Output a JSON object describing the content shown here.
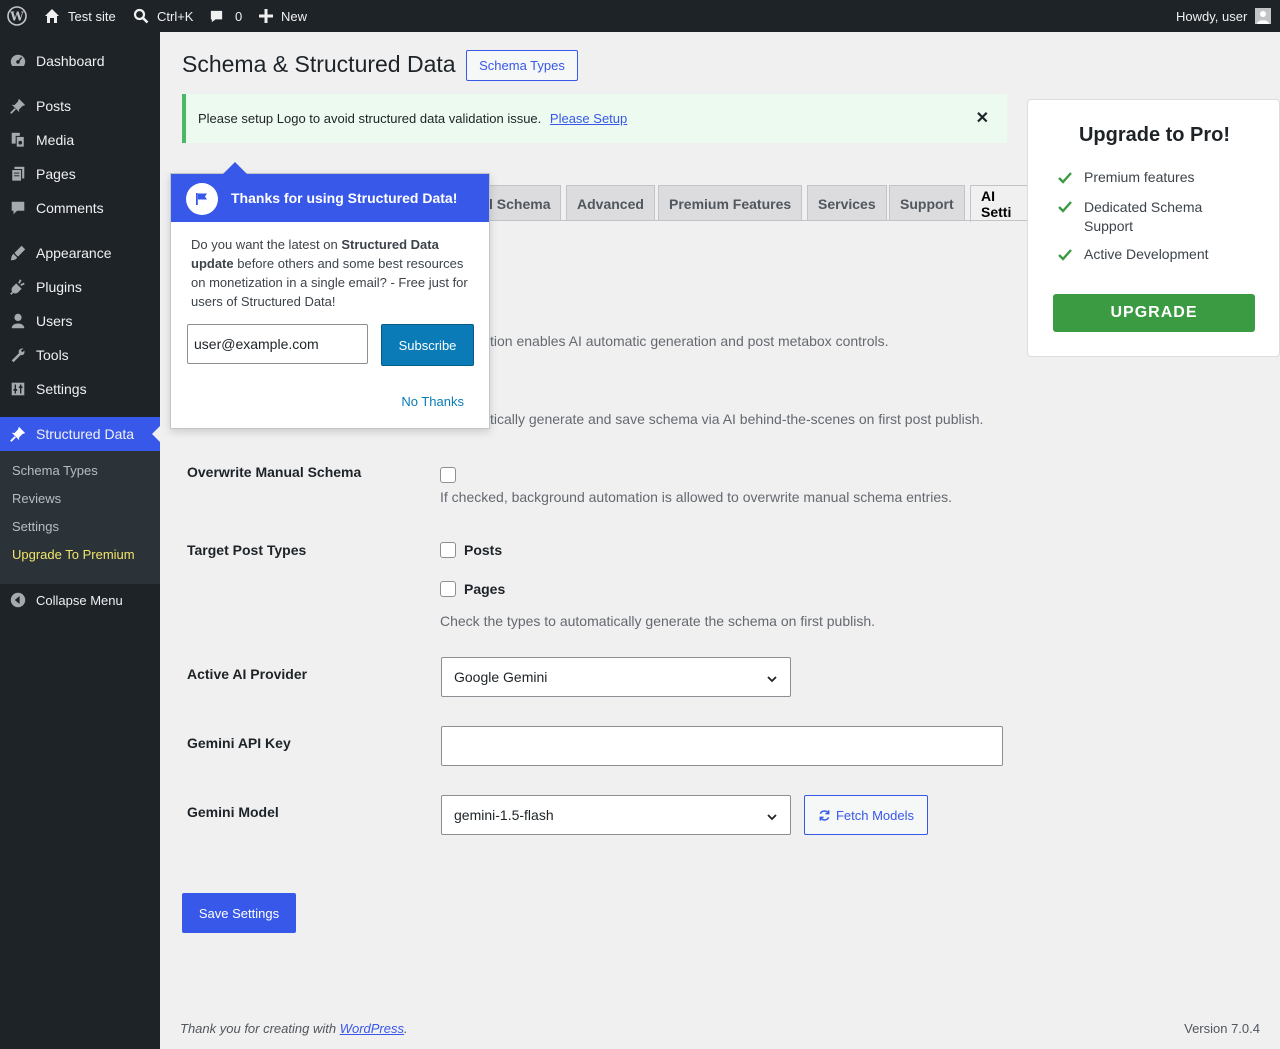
{
  "admin_bar": {
    "site_name": "Test site",
    "search_shortcut": "Ctrl+K",
    "comments_count": "0",
    "new_label": "New",
    "howdy": "Howdy, user"
  },
  "sidebar": {
    "items": [
      {
        "label": "Dashboard",
        "icon": "dashboard-icon"
      },
      {
        "label": "Posts",
        "icon": "pin-icon"
      },
      {
        "label": "Media",
        "icon": "media-icon"
      },
      {
        "label": "Pages",
        "icon": "pages-icon"
      },
      {
        "label": "Comments",
        "icon": "comment-icon"
      },
      {
        "label": "Appearance",
        "icon": "brush-icon"
      },
      {
        "label": "Plugins",
        "icon": "plugin-icon"
      },
      {
        "label": "Users",
        "icon": "user-icon"
      },
      {
        "label": "Tools",
        "icon": "wrench-icon"
      },
      {
        "label": "Settings",
        "icon": "settings-icon"
      },
      {
        "label": "Structured Data",
        "icon": "pin-icon"
      }
    ],
    "submenu": [
      "Schema Types",
      "Reviews",
      "Settings",
      "Upgrade To Premium"
    ],
    "collapse_label": "Collapse Menu",
    "active_color": "#3858e9"
  },
  "page": {
    "title": "Schema & Structured Data",
    "schema_types_button": "Schema Types"
  },
  "notice": {
    "text": "Please setup Logo to avoid structured data validation issue.",
    "link": "Please Setup",
    "close": "✕"
  },
  "tabs": [
    "l Schema",
    "Advanced",
    "Premium Features",
    "Services",
    "Support",
    "AI Setti"
  ],
  "form": {
    "partial_desc_1": "tion enables AI automatic generation and post metabox controls.",
    "partial_desc_2": "tically generate and save schema via AI behind-the-scenes on first post publish.",
    "overwrite_label": "Overwrite Manual Schema",
    "overwrite_desc": "If checked, background automation is allowed to overwrite manual schema entries.",
    "target_label": "Target Post Types",
    "posts_label": "Posts",
    "pages_label": "Pages",
    "target_desc": "Check the types to automatically generate the schema on first publish.",
    "provider_label": "Active AI Provider",
    "provider_value": "Google Gemini",
    "api_key_label": "Gemini API Key",
    "api_key_value": "",
    "model_label": "Gemini Model",
    "model_value": "gemini-1.5-flash",
    "fetch_models": "Fetch Models",
    "save": "Save Settings"
  },
  "pro_box": {
    "title": "Upgrade to Pro!",
    "features": [
      "Premium features",
      "Dedicated Schema Support",
      "Active Development"
    ],
    "button": "UPGRADE",
    "check_color": "#3b9b42"
  },
  "popup": {
    "title": "Thanks for using Structured Data!",
    "body_pre": "Do you want the latest on ",
    "body_bold1": "Structured Data update",
    "body_post": " before others and some best resources on monetization in a single email? - Free just for users of Structured Data!",
    "email_value": "user@example.com",
    "subscribe": "Subscribe",
    "no_thanks": "No Thanks"
  },
  "footer": {
    "thanks_pre": "Thank you for creating with ",
    "thanks_link": "WordPress",
    "thanks_post": ".",
    "version": "Version 7.0.4"
  }
}
